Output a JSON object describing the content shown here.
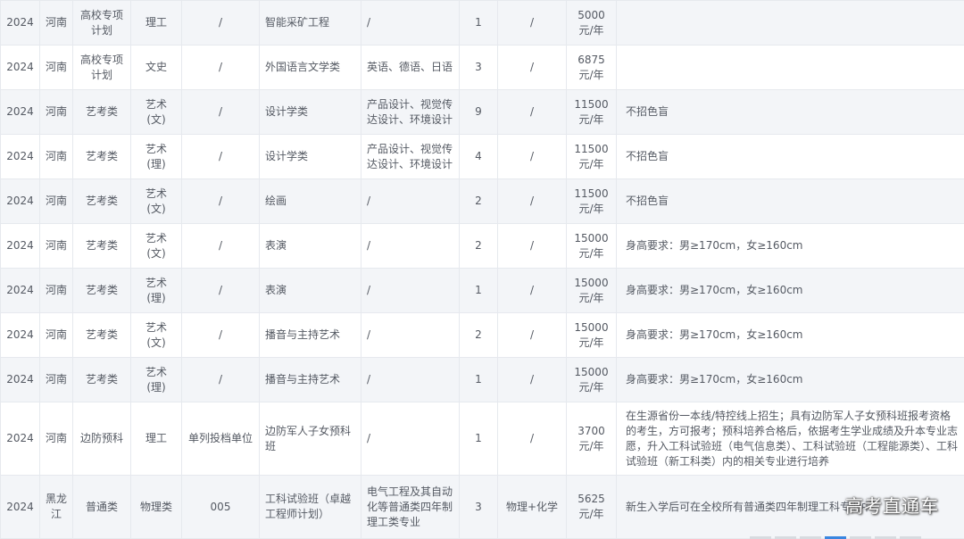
{
  "rows": [
    {
      "year": "2024",
      "province": "河南",
      "type": "高校专项计划",
      "subject": "理工",
      "code": "/",
      "major": "智能采矿工程",
      "includes": "/",
      "plan": "1",
      "req": "/",
      "fee": "5000元/年",
      "note": ""
    },
    {
      "year": "2024",
      "province": "河南",
      "type": "高校专项计划",
      "subject": "文史",
      "code": "/",
      "major": "外国语言文学类",
      "includes": "英语、德语、日语",
      "plan": "3",
      "req": "/",
      "fee": "6875元/年",
      "note": ""
    },
    {
      "year": "2024",
      "province": "河南",
      "type": "艺考类",
      "subject": "艺术(文)",
      "code": "/",
      "major": "设计学类",
      "includes": "产品设计、视觉传达设计、环境设计",
      "plan": "9",
      "req": "/",
      "fee": "11500元/年",
      "note": "不招色盲"
    },
    {
      "year": "2024",
      "province": "河南",
      "type": "艺考类",
      "subject": "艺术(理)",
      "code": "/",
      "major": "设计学类",
      "includes": "产品设计、视觉传达设计、环境设计",
      "plan": "4",
      "req": "/",
      "fee": "11500元/年",
      "note": "不招色盲"
    },
    {
      "year": "2024",
      "province": "河南",
      "type": "艺考类",
      "subject": "艺术(文)",
      "code": "/",
      "major": "绘画",
      "includes": "/",
      "plan": "2",
      "req": "/",
      "fee": "11500元/年",
      "note": "不招色盲"
    },
    {
      "year": "2024",
      "province": "河南",
      "type": "艺考类",
      "subject": "艺术(文)",
      "code": "/",
      "major": "表演",
      "includes": "/",
      "plan": "2",
      "req": "/",
      "fee": "15000元/年",
      "note": "身高要求：男≥170cm，女≥160cm"
    },
    {
      "year": "2024",
      "province": "河南",
      "type": "艺考类",
      "subject": "艺术(理)",
      "code": "/",
      "major": "表演",
      "includes": "/",
      "plan": "1",
      "req": "/",
      "fee": "15000元/年",
      "note": "身高要求：男≥170cm，女≥160cm"
    },
    {
      "year": "2024",
      "province": "河南",
      "type": "艺考类",
      "subject": "艺术(文)",
      "code": "/",
      "major": "播音与主持艺术",
      "includes": "/",
      "plan": "2",
      "req": "/",
      "fee": "15000元/年",
      "note": "身高要求：男≥170cm，女≥160cm"
    },
    {
      "year": "2024",
      "province": "河南",
      "type": "艺考类",
      "subject": "艺术(理)",
      "code": "/",
      "major": "播音与主持艺术",
      "includes": "/",
      "plan": "1",
      "req": "/",
      "fee": "15000元/年",
      "note": "身高要求：男≥170cm，女≥160cm"
    },
    {
      "year": "2024",
      "province": "河南",
      "type": "边防预科",
      "subject": "理工",
      "code": "单列投档单位",
      "major": "边防军人子女预科班",
      "includes": "/",
      "plan": "1",
      "req": "/",
      "fee": "3700元/年",
      "note": "在生源省份一本线/特控线上招生；具有边防军人子女预科班报考资格的考生，方可报考；预科培养合格后，依据考生学业成绩及升本专业志愿，升入工科试验班（电气信息类）、工科试验班（工程能源类）、工科试验班（新工科类）内的相关专业进行培养"
    },
    {
      "year": "2024",
      "province": "黑龙江",
      "type": "普通类",
      "subject": "物理类",
      "code": "005",
      "major": "工科试验班（卓越工程师计划）",
      "includes": "电气工程及其自动化等普通类四年制理工类专业",
      "plan": "3",
      "req": "物理+化学",
      "fee": "5625元/年",
      "note": "新生入学后可在全校所有普通类四年制理工科专业中"
    }
  ],
  "watermark": "高考直通车"
}
